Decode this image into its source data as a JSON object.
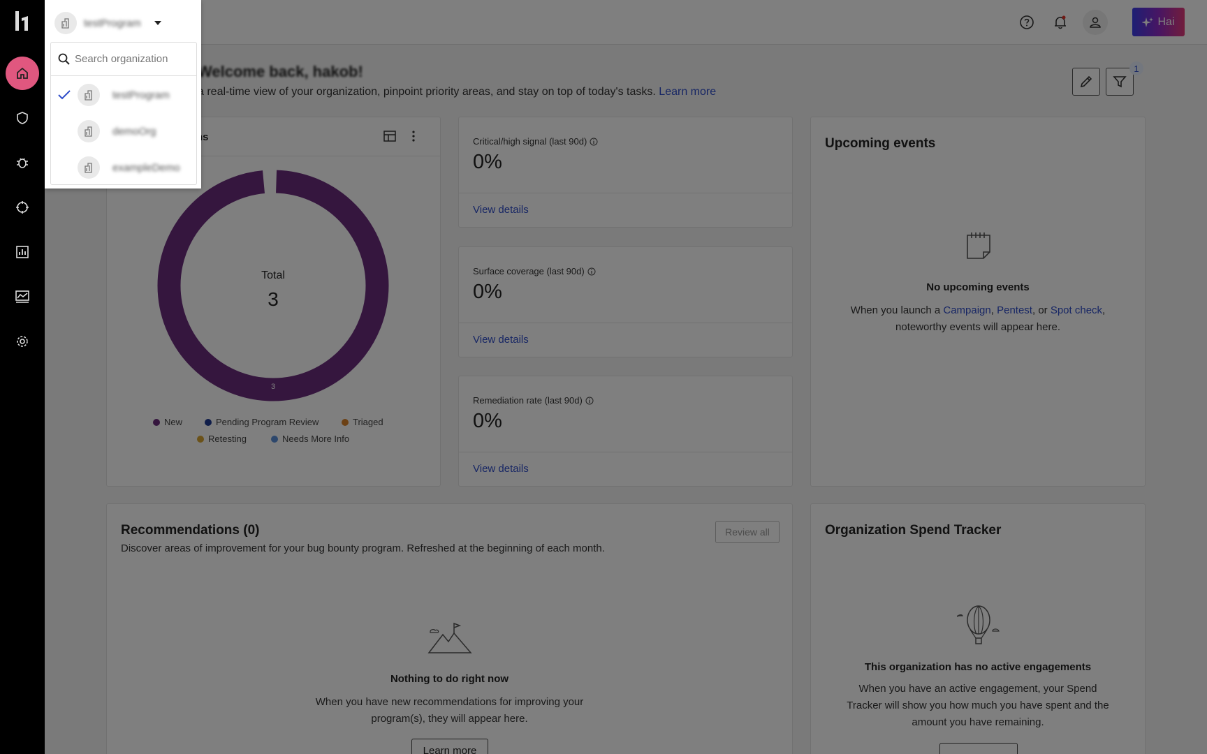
{
  "header": {
    "hai_label": "Hai"
  },
  "page": {
    "title": "Welcome back, hakob!",
    "subtitle": "a real-time view of your organization, pinpoint priority areas, and stay on top of today's tasks.",
    "learn_more": "Learn more",
    "filter_badge": "1"
  },
  "submissions": {
    "title_fragment": "ns",
    "total_label": "Total",
    "total_value": "3",
    "segment_label": "3",
    "legend": [
      "New",
      "Pending Program Review",
      "Triaged",
      "Retesting",
      "Needs More Info"
    ],
    "colors": {
      "new": "#6b2d7c",
      "pending": "#1f3a93",
      "triaged": "#d9822b",
      "retesting": "#d6a533",
      "needs_info": "#5b8fd9"
    }
  },
  "metrics": [
    {
      "label": "Critical/high signal (last 90d)",
      "value": "0%",
      "link": "View details"
    },
    {
      "label": "Surface coverage (last 90d)",
      "value": "0%",
      "link": "View details"
    },
    {
      "label": "Remediation rate (last 90d)",
      "value": "0%",
      "link": "View details"
    }
  ],
  "events": {
    "title": "Upcoming events",
    "empty_title": "No upcoming events",
    "text_before": "When you launch a",
    "campaign": "Campaign",
    "pentest": "Pentest",
    "or": "or",
    "spot_check": "Spot check",
    "text_after": "noteworthy events will appear here."
  },
  "recommendations": {
    "title": "Recommendations (0)",
    "subtitle": "Discover areas of improvement for your bug bounty program. Refreshed at the beginning of each month.",
    "review_all": "Review all",
    "empty_title": "Nothing to do right now",
    "empty_text_1": "When you have new recommendations for improving your",
    "empty_text_2": "program(s), they will appear here.",
    "learn_more_button": "Learn more"
  },
  "spend": {
    "title": "Organization Spend Tracker",
    "empty_title": "This organization has no active engagements",
    "text_1": "When you have an active engagement, your Spend",
    "text_2": "Tracker will show you how much you have spent and the",
    "text_3": "amount you have remaining."
  },
  "org_dropdown": {
    "current": "testProgram",
    "search_placeholder": "Search organization",
    "options": [
      "testProgram",
      "demoOrg",
      "exampleDemo"
    ]
  }
}
